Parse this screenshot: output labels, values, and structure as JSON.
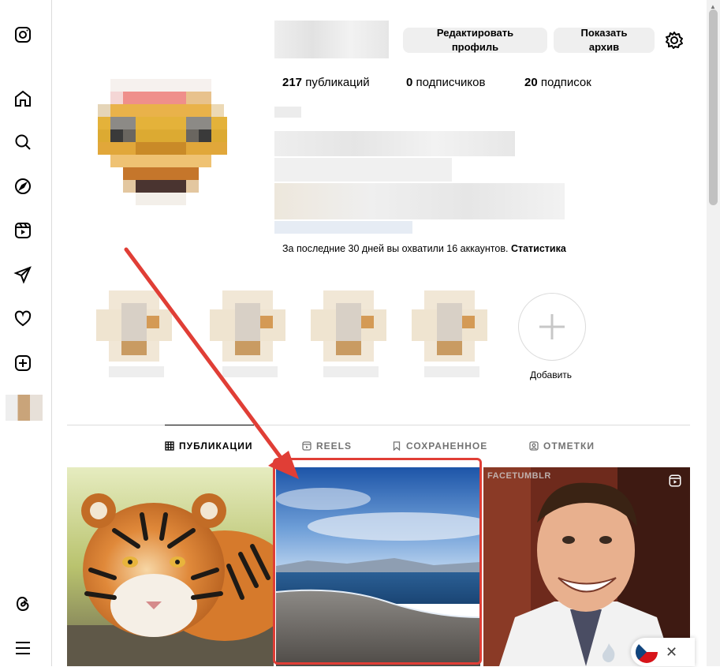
{
  "sidebar": {
    "icons": [
      "instagram-icon",
      "home-icon",
      "search-icon",
      "explore-icon",
      "reels-icon",
      "messages-icon",
      "notifications-icon",
      "create-icon",
      "threads-icon",
      "menu-icon"
    ]
  },
  "profile": {
    "edit_button": "Редактировать профиль",
    "archive_button": "Показать архив",
    "stats": {
      "posts_count": "217",
      "posts_label": "публикаций",
      "followers_count": "0",
      "followers_label": "подписчиков",
      "following_count": "20",
      "following_label": "подписок"
    },
    "reach_text": "За последние 30 дней вы охватили 16 аккаунтов.",
    "reach_link": "Статистика"
  },
  "highlights": {
    "add_label": "Добавить"
  },
  "tabs": [
    {
      "label": "ПУБЛИКАЦИИ",
      "icon": "grid-icon",
      "active": true
    },
    {
      "label": "REELS",
      "icon": "reels-icon",
      "active": false
    },
    {
      "label": "СОХРАНЕННОЕ",
      "icon": "bookmark-icon",
      "active": false
    },
    {
      "label": "ОТМЕТКИ",
      "icon": "tagged-icon",
      "active": false
    }
  ],
  "posts": [
    {
      "subject": "tiger"
    },
    {
      "subject": "sea-beach"
    },
    {
      "subject": "man-smiling",
      "watermark": "FACETUMBLR",
      "is_reel": true
    }
  ],
  "colors": {
    "highlight": "#e03e36",
    "button_bg": "#efefef",
    "border": "#dbdbdb",
    "muted_text": "#737373"
  }
}
